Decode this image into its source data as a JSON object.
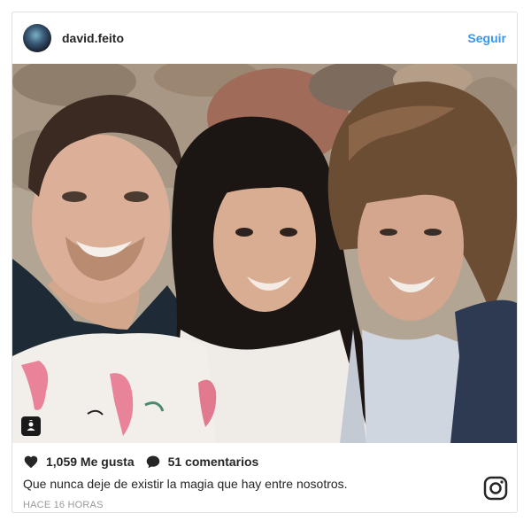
{
  "post": {
    "username": "david.feito",
    "follow_label": "Seguir",
    "likes_label": "1,059 Me gusta",
    "comments_label": "51 comentarios",
    "caption": "Que nunca deje de existir la magia que hay entre nosotros.",
    "timestamp": "HACE 16 HORAS"
  },
  "icons": {
    "avatar": "avatar",
    "like": "heart-icon",
    "comment": "comment-bubble-icon",
    "tag": "tagged-user-icon",
    "brand": "instagram-icon"
  },
  "colors": {
    "accent": "#3897f0",
    "text": "#262626",
    "muted": "#999999"
  }
}
